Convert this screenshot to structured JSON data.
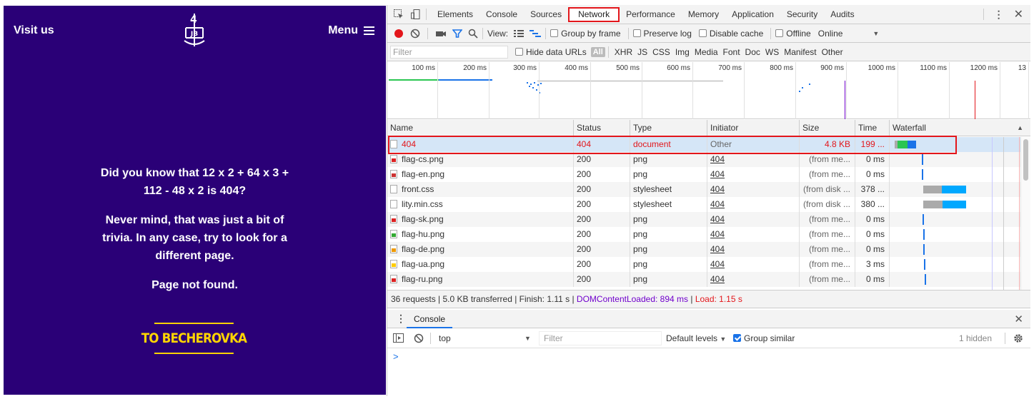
{
  "site": {
    "visit_label": "Visit us",
    "menu_label": "Menu",
    "logo_letters": "JB",
    "logo_number": "4",
    "trivia": "Did you know that 12 x 2 + 64 x 3 + 112 - 48 x 2 is 404?",
    "never_mind": "Never mind, that was just a bit of trivia. In any case, try to look for a different page.",
    "not_found": "Page not found.",
    "cta": "TO BECHEROVKA",
    "bg_color": "#2a0077",
    "cta_color": "#ffd400"
  },
  "devtools": {
    "tabs": [
      "Elements",
      "Console",
      "Sources",
      "Network",
      "Performance",
      "Memory",
      "Application",
      "Security",
      "Audits"
    ],
    "active_tab": "Network",
    "toolbar": {
      "view_label": "View:",
      "group_by_frame": "Group by frame",
      "preserve_log": "Preserve log",
      "disable_cache": "Disable cache",
      "offline": "Offline",
      "throttle": "Online"
    },
    "filter": {
      "placeholder": "Filter",
      "hide_data_urls": "Hide data URLs",
      "all": "All",
      "types": [
        "XHR",
        "JS",
        "CSS",
        "Img",
        "Media",
        "Font",
        "Doc",
        "WS",
        "Manifest",
        "Other"
      ]
    },
    "timeline_ticks": [
      "100 ms",
      "200 ms",
      "300 ms",
      "400 ms",
      "500 ms",
      "600 ms",
      "700 ms",
      "800 ms",
      "900 ms",
      "1000 ms",
      "1100 ms",
      "1200 ms",
      "13"
    ],
    "columns": {
      "name": "Name",
      "status": "Status",
      "type": "Type",
      "initiator": "Initiator",
      "size": "Size",
      "time": "Time",
      "waterfall": "Waterfall"
    },
    "rows": [
      {
        "name": "404",
        "status": "404",
        "type": "document",
        "initiator": "Other",
        "size": "4.8 KB",
        "time": "199 ...",
        "icon": "doc",
        "flag": ""
      },
      {
        "name": "flag-cs.png",
        "status": "200",
        "type": "png",
        "initiator": "404",
        "size": "(from me...",
        "time": "0 ms",
        "icon": "img",
        "flag": "#d22"
      },
      {
        "name": "flag-en.png",
        "status": "200",
        "type": "png",
        "initiator": "404",
        "size": "(from me...",
        "time": "0 ms",
        "icon": "img",
        "flag": "#c33"
      },
      {
        "name": "front.css",
        "status": "200",
        "type": "stylesheet",
        "initiator": "404",
        "size": "(from disk ...",
        "time": "378 ...",
        "icon": "doc",
        "flag": ""
      },
      {
        "name": "lity.min.css",
        "status": "200",
        "type": "stylesheet",
        "initiator": "404",
        "size": "(from disk ...",
        "time": "380 ...",
        "icon": "doc",
        "flag": ""
      },
      {
        "name": "flag-sk.png",
        "status": "200",
        "type": "png",
        "initiator": "404",
        "size": "(from me...",
        "time": "0 ms",
        "icon": "img",
        "flag": "#d22"
      },
      {
        "name": "flag-hu.png",
        "status": "200",
        "type": "png",
        "initiator": "404",
        "size": "(from me...",
        "time": "0 ms",
        "icon": "img",
        "flag": "#3a3"
      },
      {
        "name": "flag-de.png",
        "status": "200",
        "type": "png",
        "initiator": "404",
        "size": "(from me...",
        "time": "0 ms",
        "icon": "img",
        "flag": "#e90"
      },
      {
        "name": "flag-ua.png",
        "status": "200",
        "type": "png",
        "initiator": "404",
        "size": "(from me...",
        "time": "3 ms",
        "icon": "img",
        "flag": "#fc0"
      },
      {
        "name": "flag-ru.png",
        "status": "200",
        "type": "png",
        "initiator": "404",
        "size": "(from me...",
        "time": "0 ms",
        "icon": "img",
        "flag": "#d22"
      }
    ],
    "status_bar": {
      "summary": "36 requests | 5.0 KB transferred | Finish: 1.11 s | ",
      "dcl": "DOMContentLoaded: 894 ms",
      "divider": " | ",
      "load": "Load: 1.15 s"
    },
    "drawer": {
      "tab": "Console",
      "context": "top",
      "filter_placeholder": "Filter",
      "levels": "Default levels",
      "group_similar": "Group similar",
      "hidden": "1 hidden",
      "prompt": ">"
    }
  }
}
